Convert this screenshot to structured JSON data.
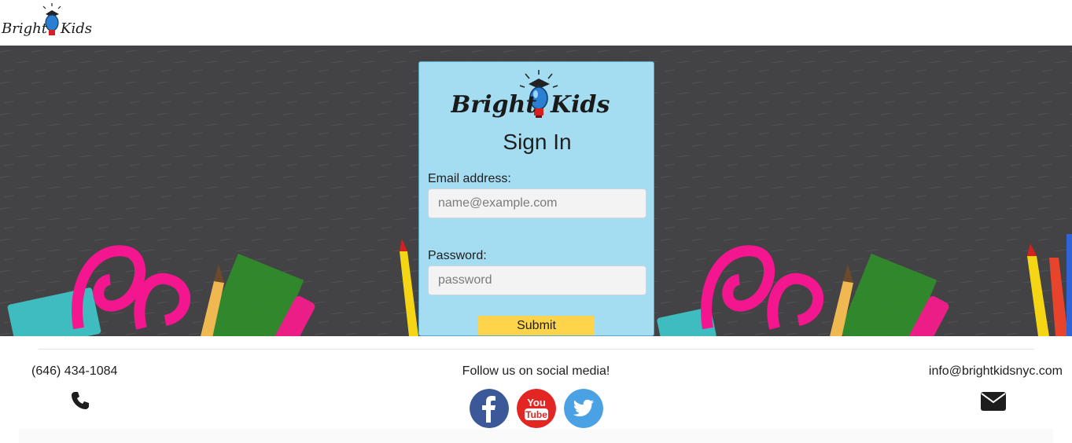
{
  "header": {
    "logo_text": "Bright Kids"
  },
  "signin": {
    "logo_text": "Bright Kids",
    "title": "Sign In",
    "email_label": "Email address:",
    "email_placeholder": "name@example.com",
    "password_label": "Password:",
    "password_placeholder": "password",
    "submit_label": "Submit"
  },
  "footer": {
    "phone": "(646) 434-1084",
    "social_heading": "Follow us on social media!",
    "email": "info@brightkidsnyc.com",
    "social_links": [
      {
        "name": "facebook",
        "icon": "facebook-icon",
        "color": "#3b5998"
      },
      {
        "name": "youtube",
        "icon": "youtube-icon",
        "color": "#e32524",
        "text_top": "You",
        "text_bottom": "Tube"
      },
      {
        "name": "twitter",
        "icon": "twitter-icon",
        "color": "#4aa1e4"
      }
    ]
  },
  "colors": {
    "card_background": "#a4dcf1",
    "submit_button": "#fdd44a",
    "chalkboard": "#403f41"
  }
}
